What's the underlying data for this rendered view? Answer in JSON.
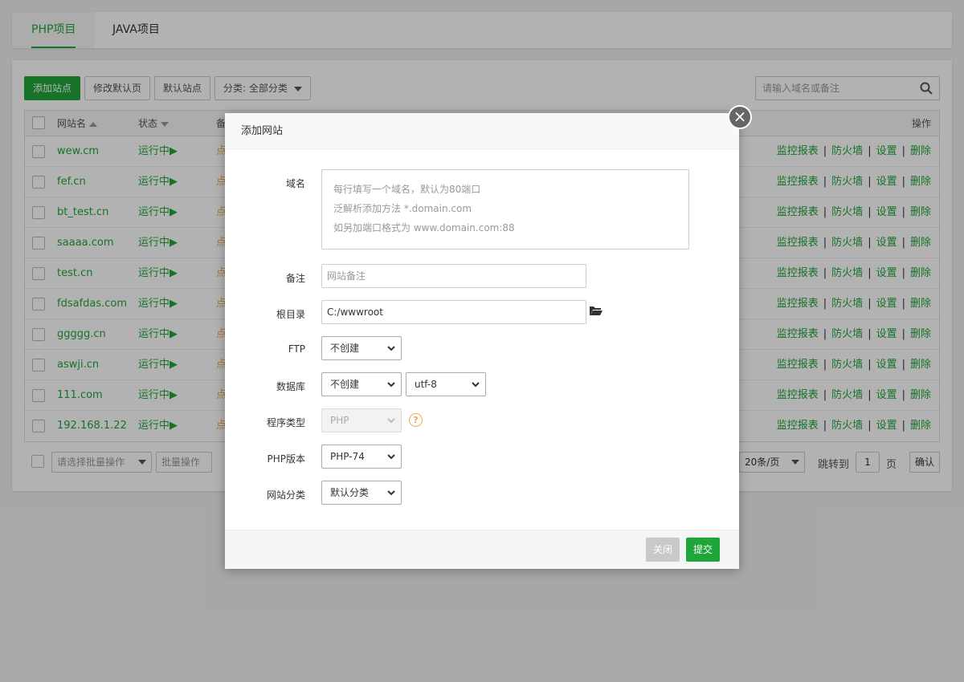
{
  "tabs": [
    {
      "label": "PHP项目",
      "active": true
    },
    {
      "label": "JAVA项目",
      "active": false
    }
  ],
  "toolbar": {
    "add_site": "添加站点",
    "modify_default_page": "修改默认页",
    "default_site": "默认站点",
    "category_filter": "分类: 全部分类"
  },
  "search": {
    "placeholder": "请输入域名或备注"
  },
  "table": {
    "headers": {
      "name": "网站名",
      "status": "状态",
      "note": "备",
      "ops": "操作"
    },
    "rows": [
      {
        "name": "wew.cm",
        "status": "运行中▶",
        "note": "点"
      },
      {
        "name": "fef.cn",
        "status": "运行中▶",
        "note": "点"
      },
      {
        "name": "bt_test.cn",
        "status": "运行中▶",
        "note": "点"
      },
      {
        "name": "saaaa.com",
        "status": "运行中▶",
        "note": "点"
      },
      {
        "name": "test.cn",
        "status": "运行中▶",
        "note": "点"
      },
      {
        "name": "fdsafdas.com",
        "status": "运行中▶",
        "note": "点"
      },
      {
        "name": "ggggg.cn",
        "status": "运行中▶",
        "note": "点"
      },
      {
        "name": "aswji.cn",
        "status": "运行中▶",
        "note": "点"
      },
      {
        "name": "111.com",
        "status": "运行中▶",
        "note": "点"
      },
      {
        "name": "192.168.1.22",
        "status": "运行中▶",
        "note": "点"
      }
    ],
    "ops": {
      "monitor": "监控报表",
      "firewall": "防火墙",
      "settings": "设置",
      "delete": "删除"
    }
  },
  "footer": {
    "batch_select_placeholder": "请选择批量操作",
    "batch_button": "批量操作",
    "page_size": "20条/页",
    "jump_to": "跳转到",
    "page_value": "1",
    "page_unit": "页",
    "confirm": "确认"
  },
  "modal": {
    "title": "添加网站",
    "labels": {
      "domain": "域名",
      "note": "备注",
      "root": "根目录",
      "ftp": "FTP",
      "database": "数据库",
      "program_type": "程序类型",
      "php_version": "PHP版本",
      "site_category": "网站分类"
    },
    "domain_placeholder_lines": [
      "每行填写一个域名，默认为80端口",
      "泛解析添加方法 *.domain.com",
      "如另加端口格式为 www.domain.com:88"
    ],
    "note_placeholder": "网站备注",
    "root_value": "C:/wwwroot",
    "ftp_value": "不创建",
    "database_value": "不创建",
    "charset_value": "utf-8",
    "program_type_value": "PHP",
    "php_version_value": "PHP-74",
    "site_category_value": "默认分类",
    "help_symbol": "?",
    "close_button": "关闭",
    "submit_button": "提交",
    "colors": {
      "accent": "#20a53a",
      "close_disabled": "#c9c9c9"
    }
  }
}
